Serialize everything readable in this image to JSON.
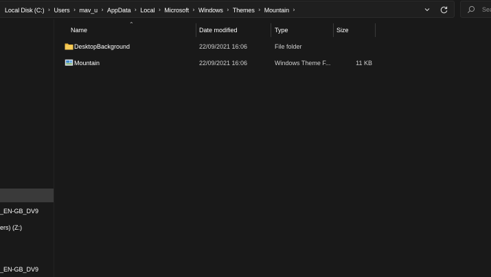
{
  "address_bar": {
    "breadcrumbs": [
      "Local Disk (C:)",
      "Users",
      "mav_u",
      "AppData",
      "Local",
      "Microsoft",
      "Windows",
      "Themes",
      "Mountain"
    ],
    "separator": "›"
  },
  "search": {
    "placeholder": "Sea"
  },
  "nav_pane": {
    "items": [
      {
        "label": "",
        "selected": true
      },
      {
        "label": "_EN-GB_DV9",
        "selected": false
      },
      {
        "label": "ers) (Z:)",
        "selected": false
      },
      {
        "label": "_EN-GB_DV9",
        "selected": false
      }
    ]
  },
  "file_list": {
    "columns": {
      "name": "Name",
      "date": "Date modified",
      "type": "Type",
      "size": "Size"
    },
    "rows": [
      {
        "name": "DesktopBackground",
        "date": "22/09/2021 16:06",
        "type": "File folder",
        "size": "",
        "icon": "folder-icon"
      },
      {
        "name": "Mountain",
        "date": "22/09/2021 16:06",
        "type": "Windows Theme F...",
        "size": "11 KB",
        "icon": "theme-file-icon"
      }
    ]
  },
  "colors": {
    "background": "#191919",
    "folder": "#f2c34d",
    "selection": "#3a3a3a"
  }
}
